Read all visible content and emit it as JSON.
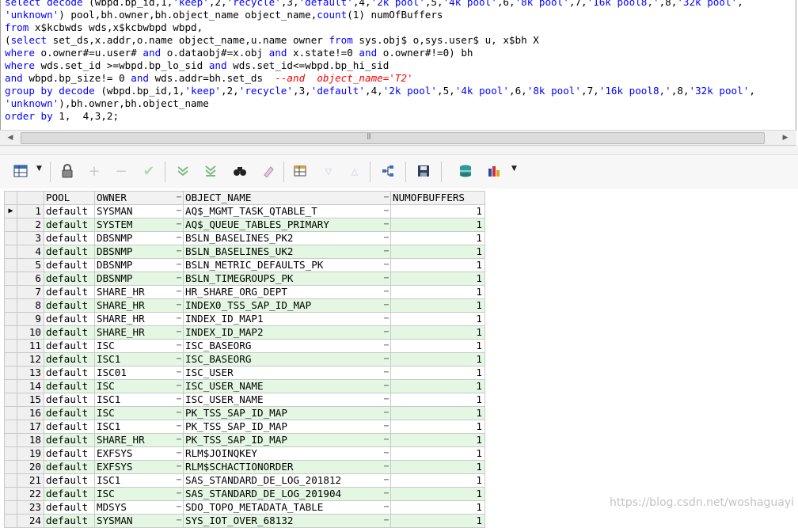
{
  "sql_lines": [
    [
      {
        "t": "select ",
        "c": "kw"
      },
      {
        "t": "decode ",
        "c": "kw"
      },
      {
        "t": "(wbpd.bp_id,1,",
        "c": ""
      },
      {
        "t": "'keep'",
        "c": "str"
      },
      {
        "t": ",2,",
        "c": ""
      },
      {
        "t": "'recycle'",
        "c": "str"
      },
      {
        "t": ",3,",
        "c": ""
      },
      {
        "t": "'default'",
        "c": "str"
      },
      {
        "t": ",4,",
        "c": ""
      },
      {
        "t": "'2k pool'",
        "c": "str"
      },
      {
        "t": ",5,",
        "c": ""
      },
      {
        "t": "'4k pool'",
        "c": "str"
      },
      {
        "t": ",6,",
        "c": ""
      },
      {
        "t": "'8k pool'",
        "c": "str"
      },
      {
        "t": ",7,",
        "c": ""
      },
      {
        "t": "'16k pool8,'",
        "c": "str"
      },
      {
        "t": ",8,",
        "c": ""
      },
      {
        "t": "'32k pool'",
        "c": "str"
      },
      {
        "t": ",",
        "c": ""
      }
    ],
    [
      {
        "t": "'unknown'",
        "c": "str"
      },
      {
        "t": ") pool,bh.owner,bh.object_name object_name,",
        "c": ""
      },
      {
        "t": "count",
        "c": "kw"
      },
      {
        "t": "(1) numOfBuffers",
        "c": ""
      }
    ],
    [
      {
        "t": "from ",
        "c": "kw"
      },
      {
        "t": "x$kcbwds wds,x$kcbwbpd wbpd,",
        "c": ""
      }
    ],
    [
      {
        "t": "(",
        "c": ""
      },
      {
        "t": "select ",
        "c": "kw"
      },
      {
        "t": "set_ds,x.addr,o.name object_name,u.name owner ",
        "c": ""
      },
      {
        "t": "from ",
        "c": "kw"
      },
      {
        "t": "sys.obj$ o,sys.user$ u, x$bh X",
        "c": ""
      }
    ],
    [
      {
        "t": "where ",
        "c": "kw"
      },
      {
        "t": "o.owner#=u.user# ",
        "c": ""
      },
      {
        "t": "and ",
        "c": "kw"
      },
      {
        "t": "o.dataobj#=x.obj ",
        "c": ""
      },
      {
        "t": "and ",
        "c": "kw"
      },
      {
        "t": "x.state!=0 ",
        "c": ""
      },
      {
        "t": "and ",
        "c": "kw"
      },
      {
        "t": "o.owner#!=0) bh",
        "c": ""
      }
    ],
    [
      {
        "t": "where ",
        "c": "kw"
      },
      {
        "t": "wds.set_id >=wbpd.bp_lo_sid ",
        "c": ""
      },
      {
        "t": "and ",
        "c": "kw"
      },
      {
        "t": "wds.set_id<=wbpd.bp_hi_sid",
        "c": ""
      }
    ],
    [
      {
        "t": "and ",
        "c": "kw"
      },
      {
        "t": "wbpd.bp_size!= 0 ",
        "c": ""
      },
      {
        "t": "and ",
        "c": "kw"
      },
      {
        "t": "wds.addr=bh.set_ds  ",
        "c": ""
      },
      {
        "t": "--and  object_name='T2'",
        "c": "cm"
      }
    ],
    [
      {
        "t": "group by ",
        "c": "kw"
      },
      {
        "t": "decode ",
        "c": "kw"
      },
      {
        "t": "(wbpd.bp_id,1,",
        "c": ""
      },
      {
        "t": "'keep'",
        "c": "str"
      },
      {
        "t": ",2,",
        "c": ""
      },
      {
        "t": "'recycle'",
        "c": "str"
      },
      {
        "t": ",3,",
        "c": ""
      },
      {
        "t": "'default'",
        "c": "str"
      },
      {
        "t": ",4,",
        "c": ""
      },
      {
        "t": "'2k pool'",
        "c": "str"
      },
      {
        "t": ",5,",
        "c": ""
      },
      {
        "t": "'4k pool'",
        "c": "str"
      },
      {
        "t": ",6,",
        "c": ""
      },
      {
        "t": "'8k pool'",
        "c": "str"
      },
      {
        "t": ",7,",
        "c": ""
      },
      {
        "t": "'16k pool8,'",
        "c": "str"
      },
      {
        "t": ",8,",
        "c": ""
      },
      {
        "t": "'32k pool'",
        "c": "str"
      },
      {
        "t": ",",
        "c": ""
      }
    ],
    [
      {
        "t": "'unknown'",
        "c": "str"
      },
      {
        "t": "),bh.owner,bh.object_name",
        "c": ""
      }
    ],
    [
      {
        "t": "order by ",
        "c": "kw"
      },
      {
        "t": "1,  4,3,2;",
        "c": ""
      }
    ]
  ],
  "colors": {
    "keyword": "#0000ff",
    "comment": "#ff0000",
    "alt_row": "#e3f7e3"
  },
  "toolbar": {
    "icons": [
      "grid-view-icon",
      "lock-icon",
      "add-record-icon",
      "delete-record-icon",
      "post-changes-icon",
      "fetch-next-icon",
      "fetch-all-icon",
      "find-icon",
      "clear-icon",
      "query-by-example-icon",
      "sort-ascending-icon",
      "sort-descending-icon",
      "tree-view-icon",
      "save-icon",
      "export-icon",
      "chart-icon"
    ]
  },
  "grid": {
    "columns": [
      "POOL",
      "OWNER",
      "OBJECT_NAME",
      "NUMOFBUFFERS"
    ],
    "ellipsis": "⋯",
    "current_row_marker": "▶",
    "rows": [
      {
        "n": "1",
        "pool": "default",
        "owner": "SYSMAN",
        "object_name": "AQ$_MGMT_TASK_QTABLE_T",
        "buffers": "1"
      },
      {
        "n": "2",
        "pool": "default",
        "owner": "SYSTEM",
        "object_name": "AQ$_QUEUE_TABLES_PRIMARY",
        "buffers": "1"
      },
      {
        "n": "3",
        "pool": "default",
        "owner": "DBSNMP",
        "object_name": "BSLN_BASELINES_PK2",
        "buffers": "1"
      },
      {
        "n": "4",
        "pool": "default",
        "owner": "DBSNMP",
        "object_name": "BSLN_BASELINES_UK2",
        "buffers": "1"
      },
      {
        "n": "5",
        "pool": "default",
        "owner": "DBSNMP",
        "object_name": "BSLN_METRIC_DEFAULTS_PK",
        "buffers": "1"
      },
      {
        "n": "6",
        "pool": "default",
        "owner": "DBSNMP",
        "object_name": "BSLN_TIMEGROUPS_PK",
        "buffers": "1"
      },
      {
        "n": "7",
        "pool": "default",
        "owner": "SHARE_HR",
        "object_name": "HR_SHARE_ORG_DEPT",
        "buffers": "1"
      },
      {
        "n": "8",
        "pool": "default",
        "owner": "SHARE_HR",
        "object_name": "INDEX0_TSS_SAP_ID_MAP",
        "buffers": "1"
      },
      {
        "n": "9",
        "pool": "default",
        "owner": "SHARE_HR",
        "object_name": "INDEX_ID_MAP1",
        "buffers": "1"
      },
      {
        "n": "10",
        "pool": "default",
        "owner": "SHARE_HR",
        "object_name": "INDEX_ID_MAP2",
        "buffers": "1"
      },
      {
        "n": "11",
        "pool": "default",
        "owner": "ISC",
        "object_name": "ISC_BASEORG",
        "buffers": "1"
      },
      {
        "n": "12",
        "pool": "default",
        "owner": "ISC1",
        "object_name": "ISC_BASEORG",
        "buffers": "1"
      },
      {
        "n": "13",
        "pool": "default",
        "owner": "ISC01",
        "object_name": "ISC_USER",
        "buffers": "1"
      },
      {
        "n": "14",
        "pool": "default",
        "owner": "ISC",
        "object_name": "ISC_USER_NAME",
        "buffers": "1"
      },
      {
        "n": "15",
        "pool": "default",
        "owner": "ISC1",
        "object_name": "ISC_USER_NAME",
        "buffers": "1"
      },
      {
        "n": "16",
        "pool": "default",
        "owner": "ISC",
        "object_name": "PK_TSS_SAP_ID_MAP",
        "buffers": "1"
      },
      {
        "n": "17",
        "pool": "default",
        "owner": "ISC1",
        "object_name": "PK_TSS_SAP_ID_MAP",
        "buffers": "1"
      },
      {
        "n": "18",
        "pool": "default",
        "owner": "SHARE_HR",
        "object_name": "PK_TSS_SAP_ID_MAP",
        "buffers": "1"
      },
      {
        "n": "19",
        "pool": "default",
        "owner": "EXFSYS",
        "object_name": "RLM$JOINQKEY",
        "buffers": "1"
      },
      {
        "n": "20",
        "pool": "default",
        "owner": "EXFSYS",
        "object_name": "RLM$SCHACTIONORDER",
        "buffers": "1"
      },
      {
        "n": "21",
        "pool": "default",
        "owner": "ISC1",
        "object_name": "SAS_STANDARD_DE_LOG_201812",
        "buffers": "1"
      },
      {
        "n": "22",
        "pool": "default",
        "owner": "ISC",
        "object_name": "SAS_STANDARD_DE_LOG_201904",
        "buffers": "1"
      },
      {
        "n": "23",
        "pool": "default",
        "owner": "MDSYS",
        "object_name": "SDO_TOPO_METADATA_TABLE",
        "buffers": "1"
      },
      {
        "n": "24",
        "pool": "default",
        "owner": "SYSMAN",
        "object_name": "SYS_IOT_OVER_68132",
        "buffers": "1"
      }
    ]
  },
  "watermark": "https://blog.csdn.net/woshaguayi"
}
